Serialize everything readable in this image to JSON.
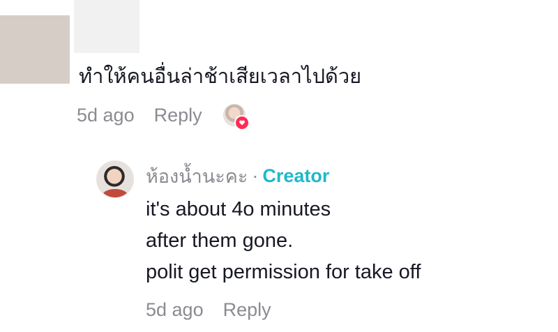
{
  "comment": {
    "text": "ทำให้คนอื่นล่าช้าเสียเวลาไปด้วย",
    "time": "5d ago",
    "reply_label": "Reply"
  },
  "reply": {
    "username": "ห้องน้ำนะคะ",
    "separator": "·",
    "badge": "Creator",
    "lines": [
      "it's about 4o minutes",
      "after them gone.",
      "polit get permission for take off"
    ],
    "time": "5d ago",
    "reply_label": "Reply"
  },
  "colors": {
    "text": "#161823",
    "muted": "#8a8b91",
    "creator": "#20b8c9",
    "like": "#fe2c55"
  }
}
